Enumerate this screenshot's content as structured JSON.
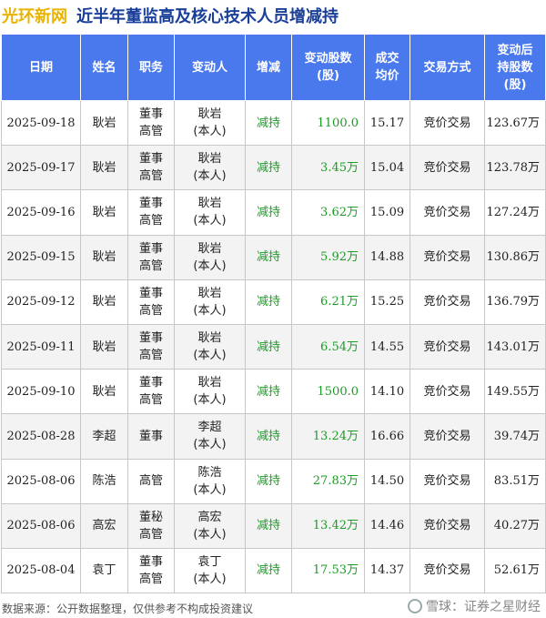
{
  "header": {
    "brand": "光环新网",
    "title": "近半年董监高及核心技术人员增减持"
  },
  "table": {
    "headers": [
      "日期",
      "姓名",
      "职务",
      "变动人",
      "增减",
      "变动股数\n(股)",
      "成交\n均价",
      "交易方式",
      "变动后\n持股数\n(股)"
    ],
    "rows": [
      [
        "2025-09-18",
        "耿岩",
        "董事\n高管",
        "耿岩\n(本人)",
        "减持",
        "1100.0",
        "15.17",
        "竞价交易",
        "123.67万"
      ],
      [
        "2025-09-17",
        "耿岩",
        "董事\n高管",
        "耿岩\n(本人)",
        "减持",
        "3.45万",
        "15.04",
        "竞价交易",
        "123.78万"
      ],
      [
        "2025-09-16",
        "耿岩",
        "董事\n高管",
        "耿岩\n(本人)",
        "减持",
        "3.62万",
        "15.09",
        "竞价交易",
        "127.24万"
      ],
      [
        "2025-09-15",
        "耿岩",
        "董事\n高管",
        "耿岩\n(本人)",
        "减持",
        "5.92万",
        "14.88",
        "竞价交易",
        "130.86万"
      ],
      [
        "2025-09-12",
        "耿岩",
        "董事\n高管",
        "耿岩\n(本人)",
        "减持",
        "6.21万",
        "15.25",
        "竞价交易",
        "136.79万"
      ],
      [
        "2025-09-11",
        "耿岩",
        "董事\n高管",
        "耿岩\n(本人)",
        "减持",
        "6.54万",
        "14.55",
        "竞价交易",
        "143.01万"
      ],
      [
        "2025-09-10",
        "耿岩",
        "董事\n高管",
        "耿岩\n(本人)",
        "减持",
        "1500.0",
        "14.10",
        "竞价交易",
        "149.55万"
      ],
      [
        "2025-08-28",
        "李超",
        "董事",
        "李超\n(本人)",
        "减持",
        "13.24万",
        "16.66",
        "竞价交易",
        "39.74万"
      ],
      [
        "2025-08-06",
        "陈浩",
        "高管",
        "陈浩\n(本人)",
        "减持",
        "27.83万",
        "14.50",
        "竞价交易",
        "83.51万"
      ],
      [
        "2025-08-06",
        "高宏",
        "董秘\n高管",
        "高宏\n(本人)",
        "减持",
        "13.42万",
        "14.46",
        "竞价交易",
        "40.27万"
      ],
      [
        "2025-08-04",
        "袁丁",
        "董事\n高管",
        "袁丁\n(本人)",
        "减持",
        "17.53万",
        "14.37",
        "竞价交易",
        "52.61万"
      ]
    ]
  },
  "footer": {
    "source": "数据来源：公开数据整理，仅供参考不构成投资建议",
    "logo_text": "雪球：证券之星财经"
  },
  "colors": {
    "header_bg": "#4a79ee",
    "brand": "#e8b400",
    "title": "#1a3f9a",
    "green": "#1e9a28"
  }
}
